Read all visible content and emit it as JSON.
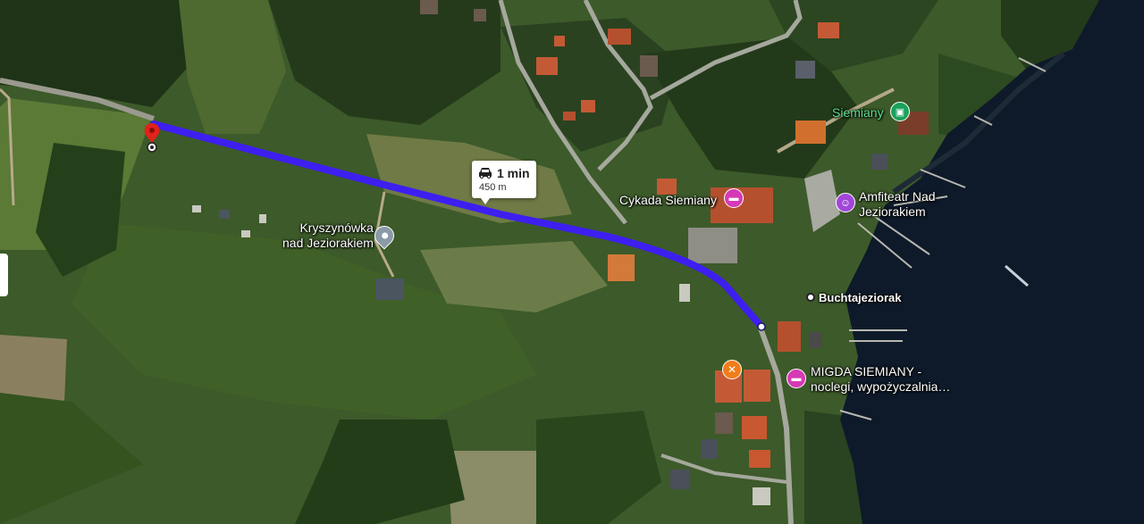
{
  "map": {
    "type": "satellite",
    "route_color": "#3d1ff0",
    "route_info": {
      "time": "1 min",
      "distance": "450 m",
      "icon": "car-icon"
    },
    "places": [
      {
        "name": "Kryszynówka\nnad Jeziorakiem",
        "line1": "Kryszynówka",
        "line2": "nad Jeziorakiem",
        "icon": "pin-icon",
        "color": "#8a9aa6"
      },
      {
        "name": "Cykada Siemiany",
        "icon": "hotel-icon",
        "color": "#d639b5"
      },
      {
        "name": "Amfiteatr Nad Jeziorakiem",
        "line1": "Amfiteatr Nad",
        "line2": "Jeziorakiem",
        "icon": "theater-icon",
        "color": "#a146d8"
      },
      {
        "name": "Siemiany",
        "icon": "train-icon",
        "color": "#1aa15a"
      },
      {
        "name": "Buchtajeziorak",
        "icon": "dot-icon",
        "color": "#ffffff"
      },
      {
        "name": "MIGDA SIEMIANY - noclegi, wypożyczalnia…",
        "line1": "MIGDA SIEMIANY -",
        "line2": "noclegi, wypożyczalnia…",
        "icon": "hotel-icon",
        "color": "#d639b5"
      },
      {
        "name": "",
        "icon": "restaurant-icon",
        "color": "#f07d1a"
      }
    ]
  }
}
